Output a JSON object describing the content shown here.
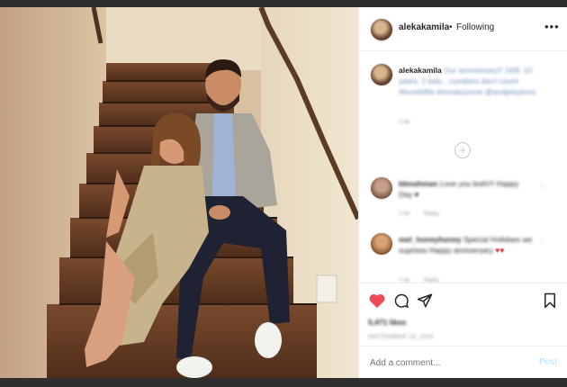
{
  "post": {
    "username": "alekakamila",
    "following_label": "Following",
    "more_label": "•••",
    "caption_user": "alekakamila",
    "caption_text": "Our anniversary!! 16/8. 10 years. 2 kids…numbers don't count #loveitsfile #mrsatuzome @andjeloylovic",
    "caption_time": "1 tie"
  },
  "comments": [
    {
      "username": "bbnuhman",
      "text": "Love you both!!! Happy Day ♥",
      "time": "1 tie",
      "reply": "Reply"
    },
    {
      "username": "mel_honeyhoney",
      "text": "Special Holidaes we suprises Happy anniversary",
      "emoji": "♥♥",
      "time": "1 tie",
      "reply": "Reply"
    }
  ],
  "stats": {
    "likes": "5,471 likes",
    "date": "SEPTEMBER 18, 2019"
  },
  "comment_box": {
    "placeholder": "Add a comment...",
    "post_label": "Post"
  },
  "icons": {
    "like": "heart-icon",
    "comment": "comment-icon",
    "share": "share-icon",
    "save": "bookmark-icon",
    "load_more": "plus-circle-icon"
  },
  "colors": {
    "liked_heart": "#ed4956",
    "post_button_disabled": "#b2dffc",
    "text": "#262626",
    "secondary": "#8e8e8e"
  }
}
